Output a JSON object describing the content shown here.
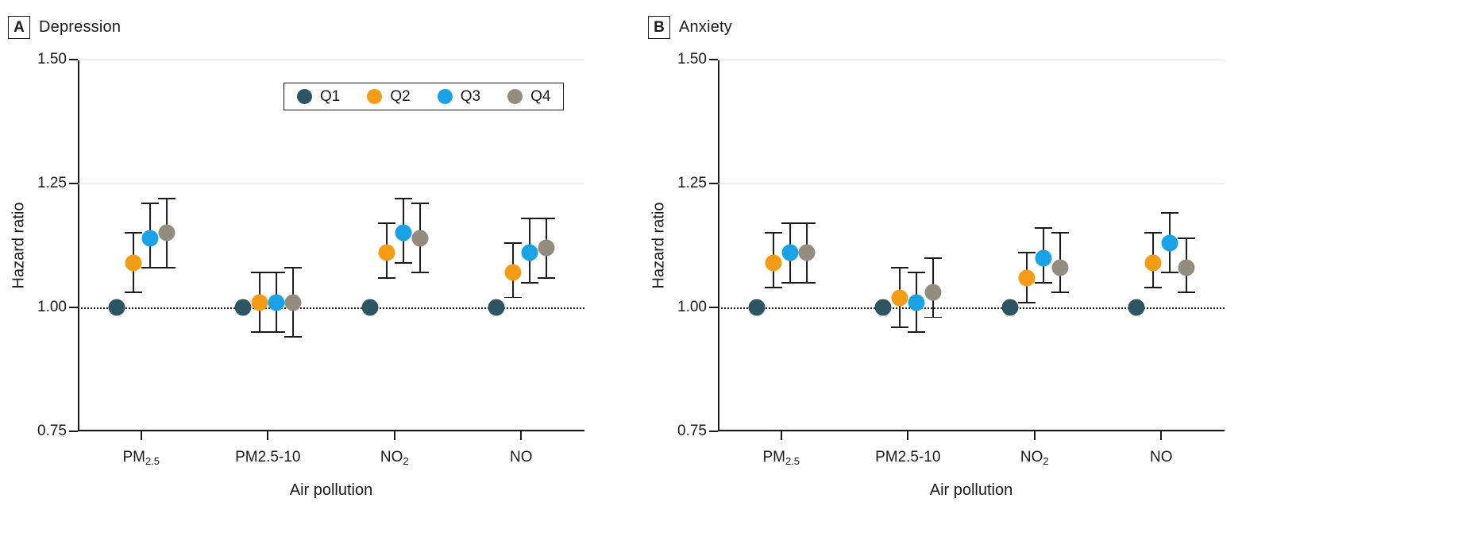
{
  "figure": {
    "axis_x_title": "Air pollution",
    "axis_y_title": "Hazard ratio",
    "y_ticks": [
      "1.50",
      "1.25",
      "1.00",
      "0.75"
    ],
    "x_ticks": [
      "PM2.5",
      "PM2.5–10",
      "NO2",
      "NO"
    ],
    "colors": {
      "q1": "#2d5564",
      "q2": "#f59c17",
      "q3": "#19a3e6",
      "q4": "#958c80",
      "axis": "#1a1a1a",
      "grid": "#e3e3e3",
      "background": "#ffffff"
    }
  },
  "legend": {
    "position": "inside-panel-a-top",
    "items": [
      {
        "label": "Q1",
        "color": "#2d5564"
      },
      {
        "label": "Q2",
        "color": "#f59c17"
      },
      {
        "label": "Q3",
        "color": "#19a3e6"
      },
      {
        "label": "Q4",
        "color": "#958c80"
      }
    ]
  },
  "panels": [
    {
      "letter": "A",
      "title": "Depression"
    },
    {
      "letter": "B",
      "title": "Anxiety"
    }
  ],
  "chart_data": [
    {
      "type": "scatter",
      "panel": "A",
      "title": "Depression",
      "xlabel": "Air pollution",
      "ylabel": "Hazard ratio",
      "ylim": [
        0.75,
        1.5
      ],
      "yticks": [
        0.75,
        1.0,
        1.25,
        1.5
      ],
      "grid": true,
      "reference_line": 1.0,
      "legend": [
        "Q1",
        "Q2",
        "Q3",
        "Q4"
      ],
      "categories": [
        "PM2.5",
        "PM2.5-10",
        "NO2",
        "NO"
      ],
      "series": [
        {
          "name": "Q1",
          "color": "#2d5564",
          "values": [
            1.0,
            1.0,
            1.0,
            1.0
          ],
          "ci_low": [
            1.0,
            1.0,
            1.0,
            1.0
          ],
          "ci_high": [
            1.0,
            1.0,
            1.0,
            1.0
          ]
        },
        {
          "name": "Q2",
          "color": "#f59c17",
          "values": [
            1.09,
            1.01,
            1.11,
            1.07
          ],
          "ci_low": [
            1.03,
            0.95,
            1.06,
            1.02
          ],
          "ci_high": [
            1.15,
            1.07,
            1.17,
            1.13
          ]
        },
        {
          "name": "Q3",
          "color": "#19a3e6",
          "values": [
            1.14,
            1.01,
            1.15,
            1.11
          ],
          "ci_low": [
            1.08,
            0.95,
            1.09,
            1.05
          ],
          "ci_high": [
            1.21,
            1.07,
            1.22,
            1.18
          ]
        },
        {
          "name": "Q4",
          "color": "#958c80",
          "values": [
            1.15,
            1.01,
            1.14,
            1.12
          ],
          "ci_low": [
            1.08,
            0.94,
            1.07,
            1.06
          ],
          "ci_high": [
            1.22,
            1.08,
            1.21,
            1.18
          ]
        }
      ]
    },
    {
      "type": "scatter",
      "panel": "B",
      "title": "Anxiety",
      "xlabel": "Air pollution",
      "ylabel": "Hazard ratio",
      "ylim": [
        0.75,
        1.5
      ],
      "yticks": [
        0.75,
        1.0,
        1.25,
        1.5
      ],
      "grid": true,
      "reference_line": 1.0,
      "legend": [
        "Q1",
        "Q2",
        "Q3",
        "Q4"
      ],
      "categories": [
        "PM2.5",
        "PM2.5-10",
        "NO2",
        "NO"
      ],
      "series": [
        {
          "name": "Q1",
          "color": "#2d5564",
          "values": [
            1.0,
            1.0,
            1.0,
            1.0
          ],
          "ci_low": [
            1.0,
            1.0,
            1.0,
            1.0
          ],
          "ci_high": [
            1.0,
            1.0,
            1.0,
            1.0
          ]
        },
        {
          "name": "Q2",
          "color": "#f59c17",
          "values": [
            1.09,
            1.02,
            1.06,
            1.09
          ],
          "ci_low": [
            1.04,
            0.96,
            1.01,
            1.04
          ],
          "ci_high": [
            1.15,
            1.08,
            1.11,
            1.15
          ]
        },
        {
          "name": "Q3",
          "color": "#19a3e6",
          "values": [
            1.11,
            1.01,
            1.1,
            1.13
          ],
          "ci_low": [
            1.05,
            0.95,
            1.05,
            1.07
          ],
          "ci_high": [
            1.17,
            1.07,
            1.16,
            1.19
          ]
        },
        {
          "name": "Q4",
          "color": "#958c80",
          "values": [
            1.11,
            1.03,
            1.08,
            1.08
          ],
          "ci_low": [
            1.05,
            0.98,
            1.03,
            1.03
          ],
          "ci_high": [
            1.17,
            1.1,
            1.15,
            1.14
          ]
        }
      ]
    }
  ]
}
